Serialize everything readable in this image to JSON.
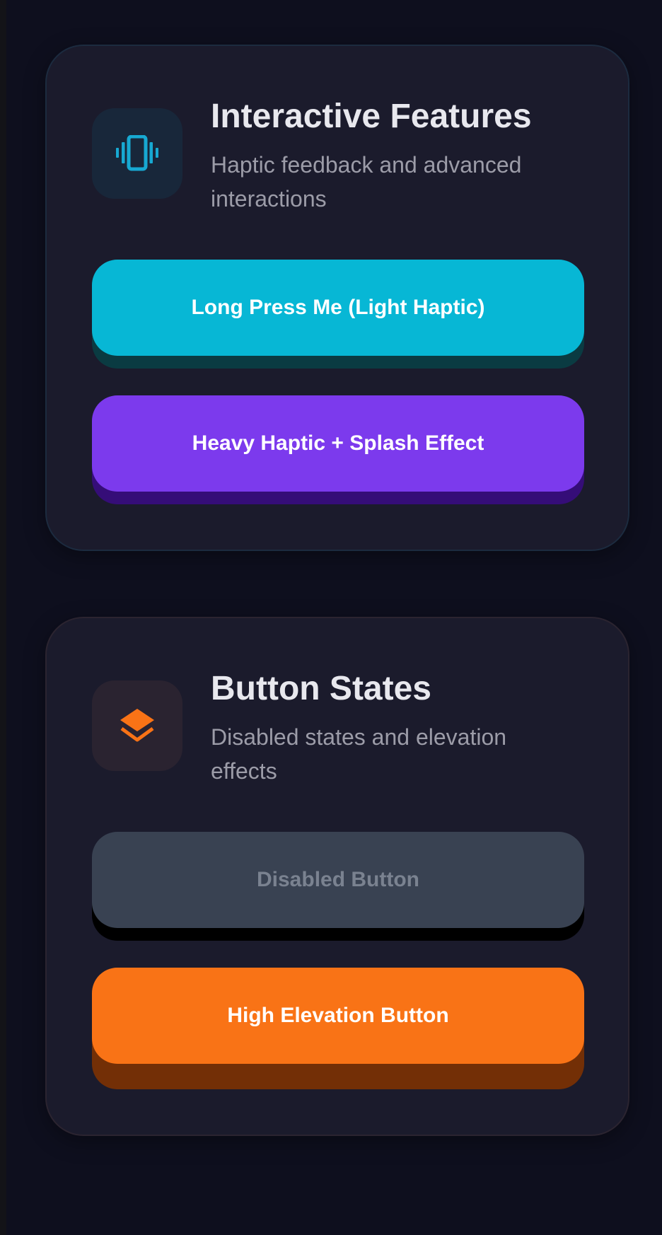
{
  "colors": {
    "background": "#0e0f1e",
    "card": "#1b1b2c",
    "cyan": "#07b7d5",
    "purple": "#7c3aed",
    "disabled": "#394252",
    "orange": "#f97316"
  },
  "interactive_card": {
    "icon": "vibration-icon",
    "title": "Interactive Features",
    "subtitle": "Haptic feedback and advanced interactions",
    "buttons": [
      {
        "label": "Long Press Me (Light Haptic)"
      },
      {
        "label": "Heavy Haptic + Splash Effect"
      }
    ]
  },
  "states_card": {
    "icon": "layers-icon",
    "title": "Button States",
    "subtitle": "Disabled states and elevation effects",
    "buttons": [
      {
        "label": "Disabled Button",
        "disabled": true
      },
      {
        "label": "High Elevation Button"
      }
    ]
  }
}
